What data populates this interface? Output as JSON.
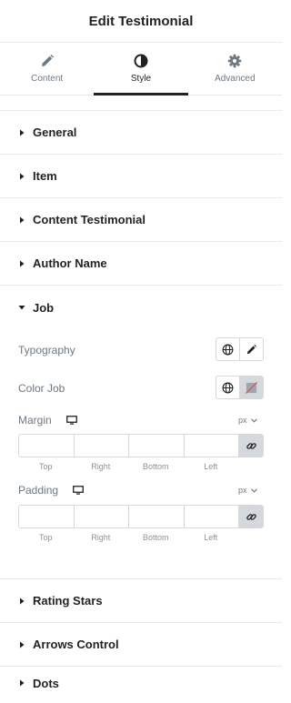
{
  "header": {
    "title": "Edit Testimonial"
  },
  "tabs": [
    {
      "label": "Content",
      "icon": "pencil-icon"
    },
    {
      "label": "Style",
      "icon": "contrast-icon"
    },
    {
      "label": "Advanced",
      "icon": "gear-icon"
    }
  ],
  "active_tab": "Style",
  "sections": {
    "general": "General",
    "item": "Item",
    "content_testimonial": "Content Testimonial",
    "author_name": "Author Name",
    "job": "Job",
    "rating_stars": "Rating Stars",
    "arrows_control": "Arrows Control",
    "dots": "Dots"
  },
  "job": {
    "typography_label": "Typography",
    "color_label": "Color Job",
    "margin": {
      "label": "Margin",
      "unit": "px",
      "values": {
        "top": "",
        "right": "",
        "bottom": "",
        "left": ""
      },
      "sides": {
        "top": "Top",
        "right": "Right",
        "bottom": "Bottom",
        "left": "Left"
      }
    },
    "padding": {
      "label": "Padding",
      "unit": "px",
      "values": {
        "top": "",
        "right": "",
        "bottom": "",
        "left": ""
      },
      "sides": {
        "top": "Top",
        "right": "Right",
        "bottom": "Bottom",
        "left": "Left"
      }
    }
  },
  "colors": {
    "text": "#1f2124",
    "muted": "#6d7882",
    "border": "#e6e8ea",
    "link_bg": "#d5d8dc",
    "swatch_slash": "#e74c3c"
  }
}
